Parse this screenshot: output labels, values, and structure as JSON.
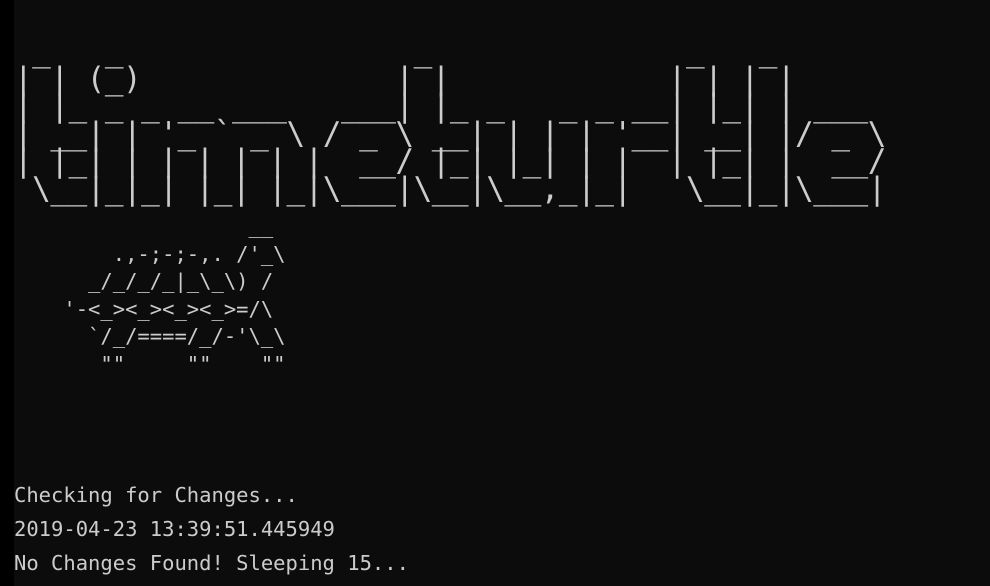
{
  "console": {
    "banner_art": " _   _                _              _   _\n| | (_)              | |            | | | |\n| |_ _ _ __ ___   ___| |_ _   _ _ __| |_| | ___\n| __| | '_ ` _ \\ / _ \\ __| | | | '__| __| |/ _ \\\n| |_| | | | | | |  __/ |_| |_| | |  | |_| |  __/\n \\__|_|_| |_| |_|\\___|\\__|\\__,_|_|   \\__|_|\\___|",
    "turtle_art": "                   __\n        .,-;-;-,. /'_\\\n      _/_/_/_|_\\_\\) /\n    '-<_><_><_><_>=/\\\n      `/_/====/_/-'\\_\\\n       \"\"     \"\"    \"\"",
    "lines": [
      "Checking for Changes...",
      "2019-04-23 13:39:51.445949",
      "No Changes Found! Sleeping 15..."
    ]
  },
  "colors": {
    "background": "#0c0c0c",
    "text": "#cccccc"
  }
}
